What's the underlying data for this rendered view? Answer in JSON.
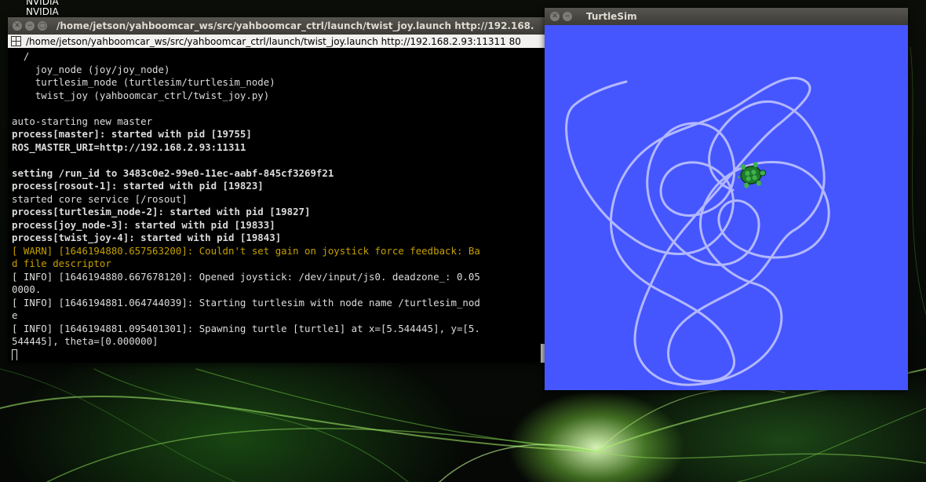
{
  "desktop": {
    "labels": [
      "NVIDIA",
      "NVIDIA"
    ]
  },
  "terminal": {
    "title": "/home/jetson/yahboomcar_ws/src/yahboomcar_ctrl/launch/twist_joy.launch http://192.168.",
    "tab_label": "/home/jetson/yahboomcar_ws/src/yahboomcar_ctrl/launch/twist_joy.launch http://192.168.2.93:11311 80",
    "lines": [
      {
        "text": "  /",
        "style": "normal"
      },
      {
        "text": "    joy_node (joy/joy_node)",
        "style": "normal"
      },
      {
        "text": "    turtlesim_node (turtlesim/turtlesim_node)",
        "style": "normal"
      },
      {
        "text": "    twist_joy (yahboomcar_ctrl/twist_joy.py)",
        "style": "normal"
      },
      {
        "text": "",
        "style": "normal"
      },
      {
        "text": "auto-starting new master",
        "style": "normal"
      },
      {
        "text": "process[master]: started with pid [19755]",
        "style": "bold"
      },
      {
        "text": "ROS_MASTER_URI=http://192.168.2.93:11311",
        "style": "bold"
      },
      {
        "text": "",
        "style": "normal"
      },
      {
        "text": "setting /run_id to 3483c0e2-99e0-11ec-aabf-845cf3269f21",
        "style": "bold"
      },
      {
        "text": "process[rosout-1]: started with pid [19823]",
        "style": "bold"
      },
      {
        "text": "started core service [/rosout]",
        "style": "normal"
      },
      {
        "text": "process[turtlesim_node-2]: started with pid [19827]",
        "style": "bold"
      },
      {
        "text": "process[joy_node-3]: started with pid [19833]",
        "style": "bold"
      },
      {
        "text": "process[twist_joy-4]: started with pid [19843]",
        "style": "bold"
      },
      {
        "text": "[ WARN] [1646194880.657563200]: Couldn't set gain on joystick force feedback: Ba",
        "style": "warn"
      },
      {
        "text": "d file descriptor",
        "style": "warn"
      },
      {
        "text": "[ INFO] [1646194880.667678120]: Opened joystick: /dev/input/js0. deadzone_: 0.05",
        "style": "normal"
      },
      {
        "text": "0000.",
        "style": "normal"
      },
      {
        "text": "[ INFO] [1646194881.064744039]: Starting turtlesim with node name /turtlesim_nod",
        "style": "normal"
      },
      {
        "text": "e",
        "style": "normal"
      },
      {
        "text": "[ INFO] [1646194881.095401301]: Spawning turtle [turtle1] at x=[5.544445], y=[5.",
        "style": "normal"
      },
      {
        "text": "544445], theta=[0.000000]",
        "style": "normal"
      }
    ]
  },
  "turtlesim": {
    "title": "TurtleSim",
    "background_color": "#4556ff",
    "pen_color": "#b3b8ff",
    "turtle_icon": "turtle-icon"
  },
  "colors": {
    "titlebar": "#3c3b37",
    "terminal_bg": "#000000",
    "warn_text": "#c4a000"
  }
}
